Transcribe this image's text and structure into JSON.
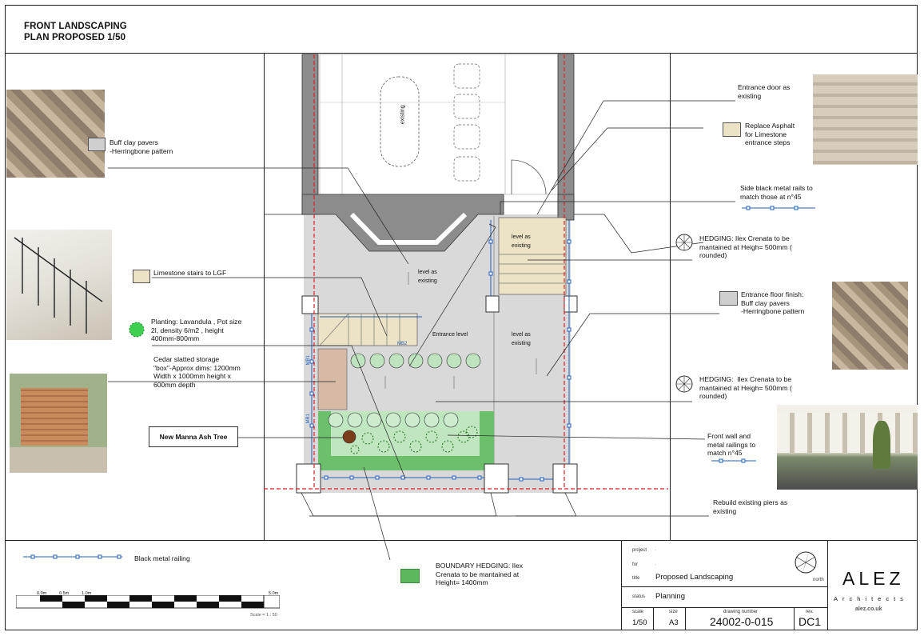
{
  "title": {
    "line1": "FRONT LANDSCAPING",
    "line2": "PLAN PROPOSED 1/50"
  },
  "notes": {
    "buff_pavers": "Buff clay pavers\n-Herringbone pattern",
    "limestone_stairs": "Limestone stairs to LGF",
    "planting": "Planting: Lavandula , Pot size\n2l, density 6/m2 , height\n400mm-800mm",
    "storage": "Cedar slatted storage\n\"box\"-Approx dims: 1200mm\nWidth x 1000mm height x\n600mm depth",
    "ash_tree": "New Manna Ash Tree",
    "entrance_door": "Entrance door as\nexisting",
    "replace_asphalt": "Replace Asphalt\nfor Limestone\nentrance steps",
    "side_rails": "Side black metal rails to\nmatch those at n°45",
    "hedging1": "HEDGING: Ilex Crenata to be\nmantained at Heigh= 500mm (\nrounded)",
    "entrance_floor": "Entrance floor finish:\nBuff clay pavers\n-Herringbone pattern",
    "hedging2": "HEDGING:  Ilex Crenata to be\nmantained at Heigh= 500mm (\nrounded)",
    "front_wall": "Front wall and\nmetal railings to\nmatch n°45",
    "rebuild_piers": "Rebuild existing piers as\nexisting",
    "boundary_hedging": "BOUNDARY HEDGING: Ilex\nCrenata to be mantained at\nHeight= 1400mm",
    "black_railing": "Black metal railing"
  },
  "plan_labels": {
    "existing": "existing",
    "level_existing_1": "level as\nexisting",
    "level_existing_2": "level as\nexisting",
    "level_existing_3": "level as\nexisting",
    "entrance_level": "Entrance level",
    "mb2": "MB2",
    "mb1a": "MB1",
    "mb1b": "MB1"
  },
  "scale_bar": {
    "t0": "0.0m",
    "t1": "0.5m",
    "t2": "1.0m",
    "t3": "5.0m",
    "caption": "Scale = 1 : 50"
  },
  "title_block": {
    "project_label": "project",
    "project_value": "-",
    "for_label": "for",
    "for_value": "-",
    "title_label": "title",
    "title_value": "Proposed Landscaping",
    "status_label": "status",
    "status_value": "Planning",
    "scale_label": "scale",
    "scale_value": "1/50",
    "size_label": "size",
    "size_value": "A3",
    "drawing_label": "drawing number",
    "drawing_value": "24002-0-015",
    "rev_label": "rev.",
    "rev_value": "DC1",
    "north": "north"
  },
  "brand": {
    "name": "ALEZ",
    "sub": "Architects",
    "url": "alez.co.uk"
  },
  "colors": {
    "hedge": "#5cb85c",
    "paver": "#cfcfcf",
    "limestone": "#ece3c6",
    "railing": "#1f5fbf",
    "boundary": "#e02020"
  }
}
